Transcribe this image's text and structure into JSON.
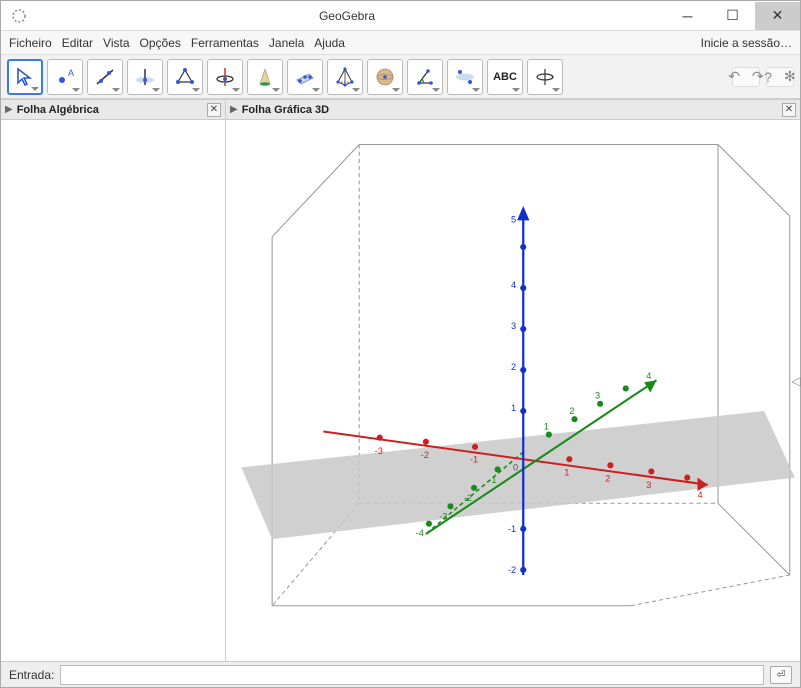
{
  "window": {
    "title": "GeoGebra"
  },
  "menubar": {
    "items": [
      "Ficheiro",
      "Editar",
      "Vista",
      "Opções",
      "Ferramentas",
      "Janela",
      "Ajuda"
    ],
    "session": "Inicie a sessão…"
  },
  "toolbar": {
    "tools": [
      {
        "name": "move-tool",
        "active": true
      },
      {
        "name": "point-tool"
      },
      {
        "name": "line-tool"
      },
      {
        "name": "perpendicular-tool"
      },
      {
        "name": "polygon-tool"
      },
      {
        "name": "circle-axis-tool"
      },
      {
        "name": "intersect-surfaces-tool"
      },
      {
        "name": "plane-tool"
      },
      {
        "name": "pyramid-tool"
      },
      {
        "name": "sphere-tool"
      },
      {
        "name": "angle-tool"
      },
      {
        "name": "reflect-tool"
      },
      {
        "name": "text-tool",
        "label": "ABC"
      },
      {
        "name": "rotate-view-tool"
      }
    ]
  },
  "panels": {
    "algebra": {
      "title": "Folha Algébrica"
    },
    "graphics3d": {
      "title": "Folha Gráfica 3D"
    }
  },
  "statusbar": {
    "label": "Entrada:",
    "value": ""
  },
  "axes3d": {
    "z_ticks": [
      "5",
      "4",
      "3",
      "2",
      "1",
      "-1",
      "-2"
    ],
    "x_neg": [
      "-3",
      "-2",
      "-1"
    ],
    "x_pos": [
      "1",
      "2",
      "3",
      "4"
    ],
    "y_front": [
      "-1",
      "-2",
      "-3",
      "-4"
    ],
    "y_back": [
      "1",
      "2",
      "3",
      "4"
    ],
    "origin": "0"
  }
}
